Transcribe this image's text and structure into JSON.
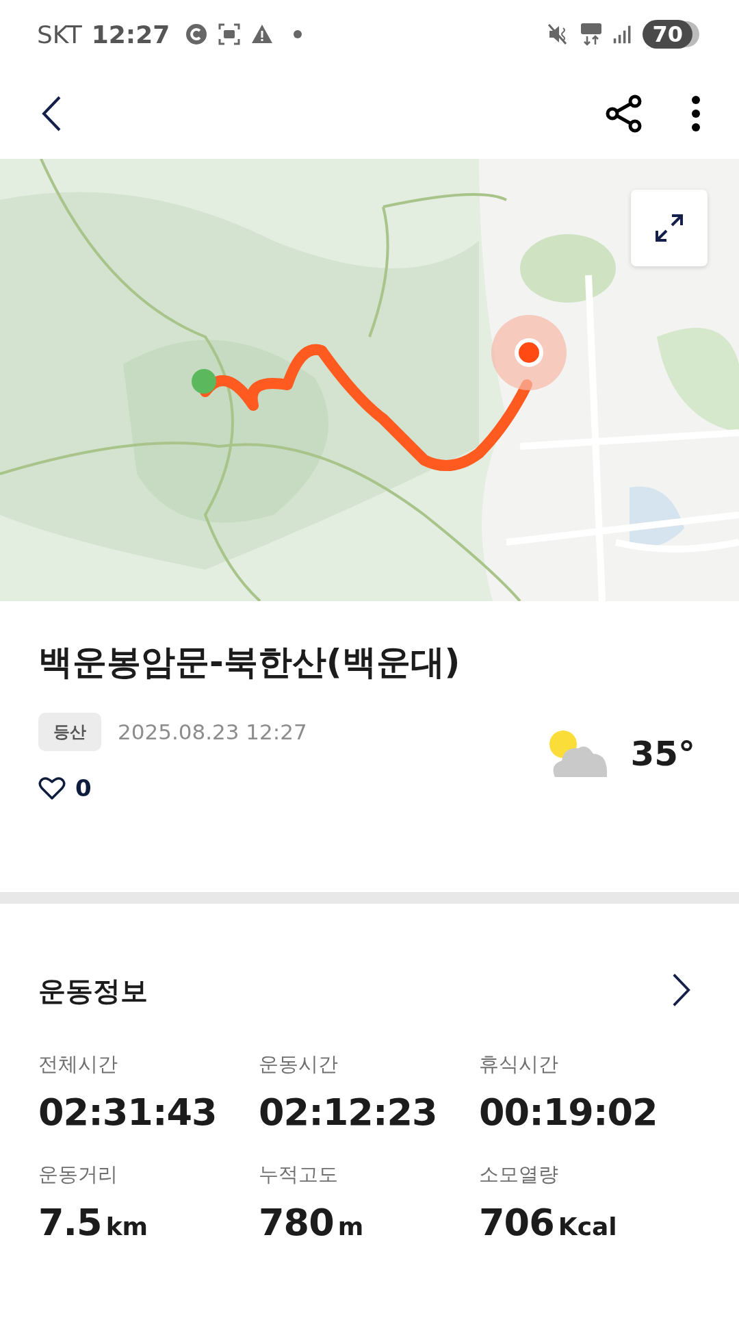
{
  "status_bar": {
    "carrier": "SKT",
    "time": "12:27",
    "battery": "70"
  },
  "activity": {
    "title": "백운봉암문-북한산(백운대)",
    "tag": "등산",
    "date": "2025.08.23 12:27",
    "likes": "0",
    "temperature": "35°"
  },
  "workout": {
    "title": "운동정보",
    "stats": [
      {
        "label": "전체시간",
        "value": "02:31:43"
      },
      {
        "label": "운동시간",
        "value": "02:12:23"
      },
      {
        "label": "휴식시간",
        "value": "00:19:02"
      },
      {
        "label": "운동거리",
        "value": "7.5",
        "unit": "km"
      },
      {
        "label": "누적고도",
        "value": "780",
        "unit": "m"
      },
      {
        "label": "소모열량",
        "value": "706",
        "unit": "Kcal"
      }
    ]
  }
}
